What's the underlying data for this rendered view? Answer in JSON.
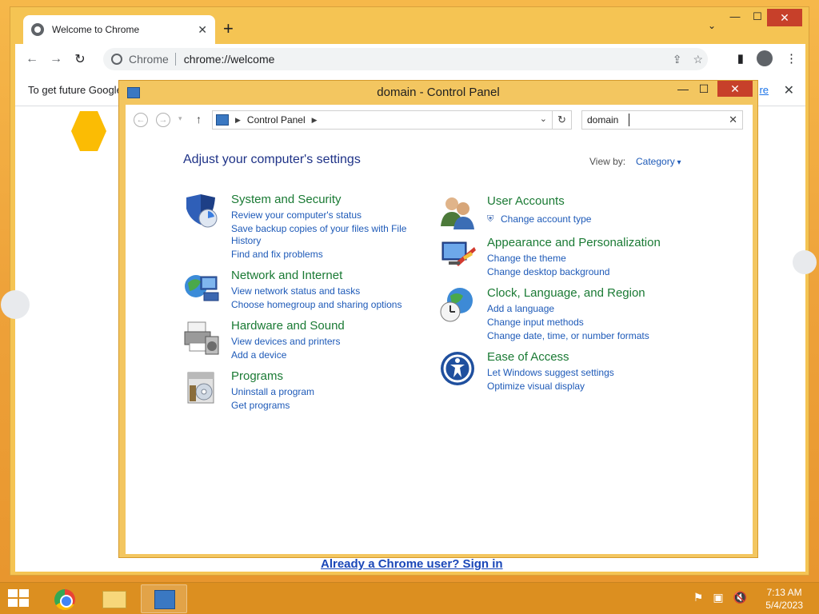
{
  "chrome": {
    "tab_title": "Welcome to Chrome",
    "new_tab": "+",
    "omnibox_site": "Chrome",
    "omnibox_url": "chrome://welcome",
    "infobar_text": "To get future Google",
    "infobar_link": "re",
    "signin_link": "Already a Chrome user? Sign in"
  },
  "control_panel": {
    "window_title": "domain - Control Panel",
    "breadcrumb": "Control Panel",
    "search_value": "domain",
    "heading": "Adjust your computer's settings",
    "view_by_label": "View by:",
    "view_by_value": "Category",
    "categories": [
      {
        "title": "System and Security",
        "links": [
          "Review your computer's status",
          "Save backup copies of your files with File",
          "History",
          "Find and fix problems"
        ]
      },
      {
        "title": "Network and Internet",
        "links": [
          "View network status and tasks",
          "Choose homegroup and sharing options"
        ]
      },
      {
        "title": "Hardware and Sound",
        "links": [
          "View devices and printers",
          "Add a device"
        ]
      },
      {
        "title": "Programs",
        "links": [
          "Uninstall a program",
          "Get programs"
        ]
      },
      {
        "title": "User Accounts",
        "links": [
          "Change account type"
        ]
      },
      {
        "title": "Appearance and Personalization",
        "links": [
          "Change the theme",
          "Change desktop background"
        ]
      },
      {
        "title": "Clock, Language, and Region",
        "links": [
          "Add a language",
          "Change input methods",
          "Change date, time, or number formats"
        ]
      },
      {
        "title": "Ease of Access",
        "links": [
          "Let Windows suggest settings",
          "Optimize visual display"
        ]
      }
    ]
  },
  "taskbar": {
    "time": "7:13 AM",
    "date": "5/4/2023"
  },
  "colors": {
    "accent_window": "#f3c660",
    "link_blue": "#1e5ab8",
    "category_green": "#1a7a34",
    "close_red": "#c7402a"
  }
}
